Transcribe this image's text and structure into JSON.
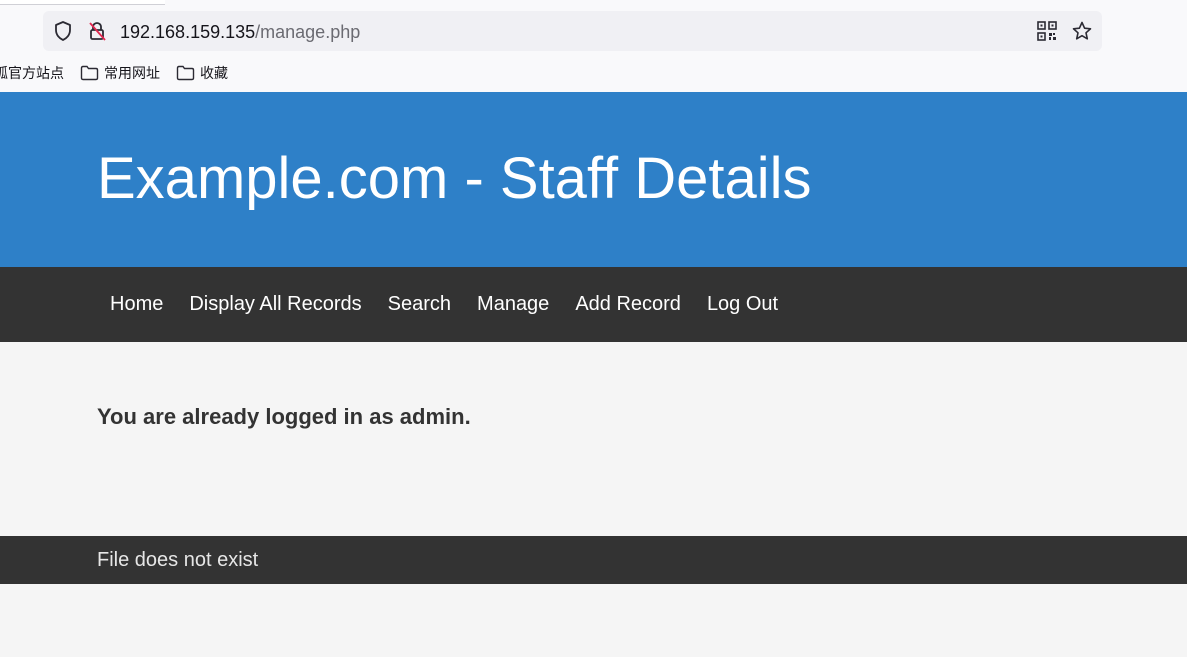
{
  "browser": {
    "url_host": "192.168.159.135",
    "url_path": "/manage.php",
    "bookmarks": [
      {
        "label": "狐官方站点",
        "icon": "bookmark-folder-icon"
      },
      {
        "label": "常用网址",
        "icon": "folder-icon"
      },
      {
        "label": "收藏",
        "icon": "folder-icon"
      }
    ],
    "icons": [
      "shield-icon",
      "insecure-lock-icon",
      "qr-code-icon",
      "star-icon"
    ]
  },
  "header": {
    "title": "Example.com - Staff Details"
  },
  "nav": {
    "items": [
      {
        "label": "Home"
      },
      {
        "label": "Display All Records"
      },
      {
        "label": "Search"
      },
      {
        "label": "Manage"
      },
      {
        "label": "Add Record"
      },
      {
        "label": "Log Out"
      }
    ]
  },
  "main": {
    "message": "You are already logged in as admin."
  },
  "footer": {
    "text": "File does not exist"
  },
  "colors": {
    "header_bg": "#2e80c8",
    "nav_bg": "#333333",
    "page_bg": "#f5f5f5",
    "footer_bg": "#333333"
  }
}
